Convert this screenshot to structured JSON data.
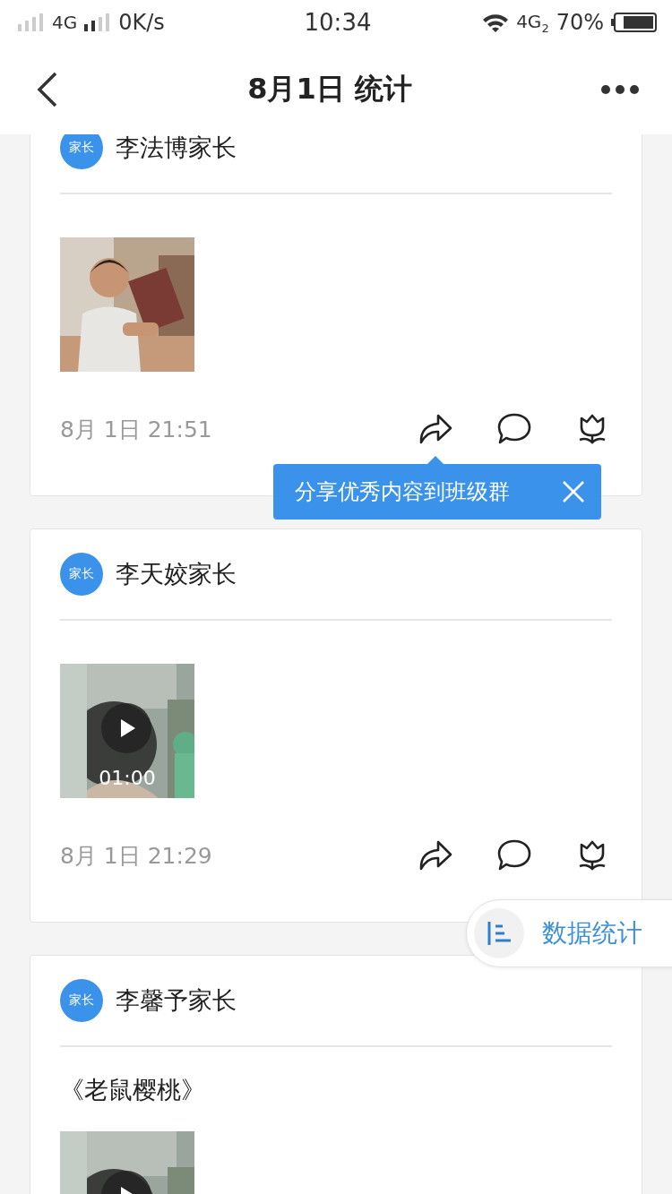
{
  "status_bar": {
    "network_left": "4G",
    "speed": "0K/s",
    "time": "10:34",
    "network_right": "4G",
    "sim": "2",
    "battery": "70%"
  },
  "nav": {
    "title": "8月1日 统计"
  },
  "posts": [
    {
      "badge": "家长",
      "author": "李法博家长",
      "time": "8月 1日 21:51"
    },
    {
      "badge": "家长",
      "author": "李天姣家长",
      "media": {
        "kind": "video",
        "duration": "01:00"
      },
      "time": "8月 1日 21:29"
    },
    {
      "badge": "家长",
      "author": "李馨予家长",
      "text": "《老鼠樱桃》",
      "media": {
        "kind": "video"
      }
    }
  ],
  "tooltip": {
    "text": "分享优秀内容到班级群"
  },
  "stats_button": {
    "label": "数据统计"
  }
}
